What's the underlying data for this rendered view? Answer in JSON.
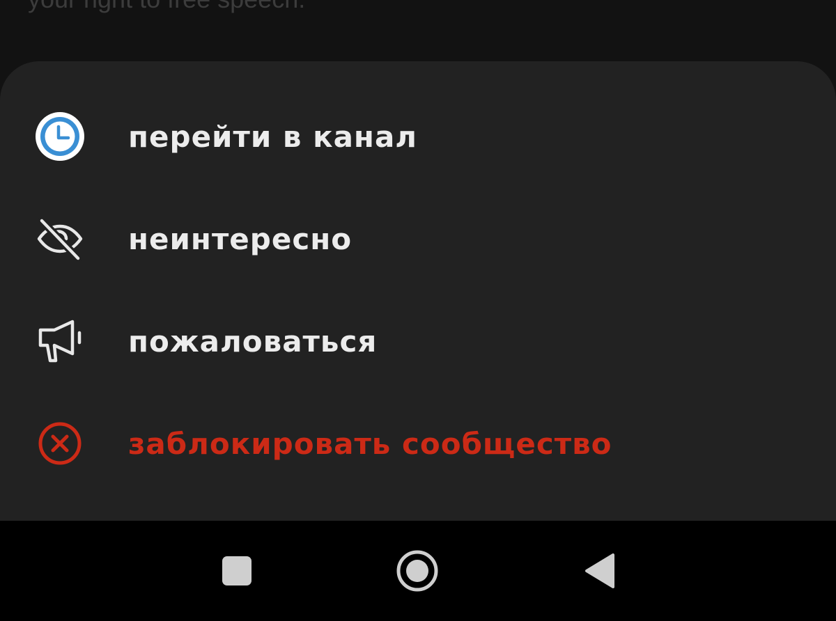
{
  "background_post": {
    "text": "your right to free speech."
  },
  "menu": {
    "items": [
      {
        "label": "перейти в канал",
        "icon": "clock-icon"
      },
      {
        "label": "неинтересно",
        "icon": "eye-off-icon"
      },
      {
        "label": "пожаловаться",
        "icon": "megaphone-icon"
      },
      {
        "label": "заблокировать сообщество",
        "icon": "block-circle-icon"
      }
    ]
  },
  "colors": {
    "sheet_background": "#222222",
    "label_text": "#ececec",
    "danger": "#cc2a16",
    "clock_accent": "#3a8fd4",
    "navbar": "#000000"
  },
  "navbar": {
    "buttons": [
      "recents-button",
      "home-button",
      "back-button"
    ]
  }
}
